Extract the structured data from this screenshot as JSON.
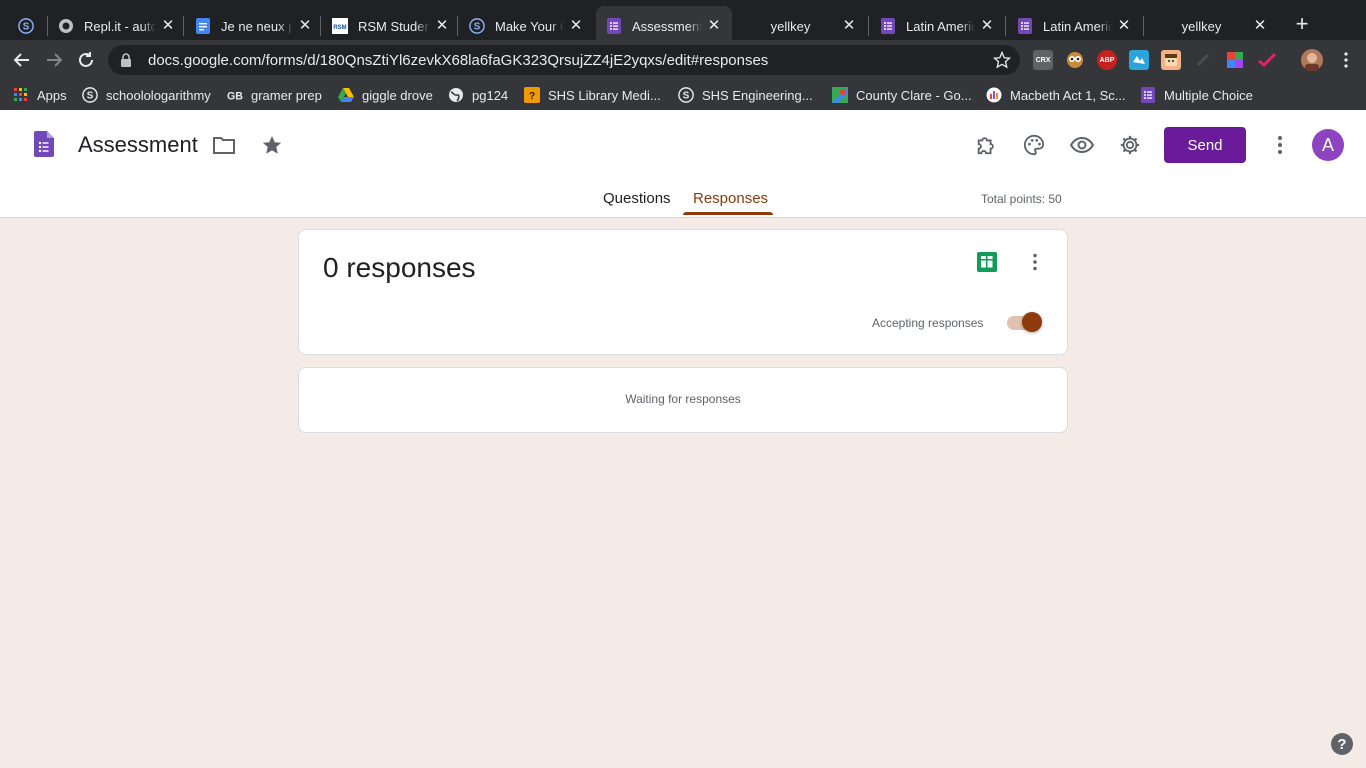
{
  "browser": {
    "tabs": [
      {
        "title": "",
        "icon": "schoology-icon"
      },
      {
        "title": "Repl.it - auto",
        "icon": "replit-icon"
      },
      {
        "title": "Je ne neux pas",
        "icon": "docs-icon"
      },
      {
        "title": "RSM Student",
        "icon": "rsm-icon"
      },
      {
        "title": "Make Your O",
        "icon": "schoology-icon"
      },
      {
        "title": "Assessment",
        "icon": "forms-icon",
        "active": true
      },
      {
        "title": "yellkey",
        "icon": ""
      },
      {
        "title": "Latin Americ",
        "icon": "forms-icon"
      },
      {
        "title": "Latin Americ",
        "icon": "forms-icon"
      },
      {
        "title": "yellkey",
        "icon": ""
      }
    ],
    "new_tab": "+",
    "url": "docs.google.com/forms/d/180QnsZtiYl6zevkX68la6faGK323QrsujZZ4jE2yqxs/edit#responses",
    "extensions": [
      {
        "label": "CRX",
        "icon": "crx-icon"
      },
      {
        "label": "",
        "icon": "owl-icon"
      },
      {
        "label": "ABP",
        "icon": "adblock-icon"
      },
      {
        "label": "",
        "icon": "ext-icon"
      },
      {
        "label": "",
        "icon": "face-icon"
      },
      {
        "label": "",
        "icon": "ext-icon"
      },
      {
        "label": "",
        "icon": "color-icon"
      },
      {
        "label": "",
        "icon": "check-icon"
      }
    ],
    "bookmarks": [
      {
        "label": "Apps",
        "icon": "apps-grid-icon"
      },
      {
        "label": "schoolologarithmy",
        "icon": "schoology-icon"
      },
      {
        "label": "gramer prep",
        "icon": "gb-icon"
      },
      {
        "label": "giggle drove",
        "icon": "drive-icon"
      },
      {
        "label": "pg124",
        "icon": "globe-icon"
      },
      {
        "label": "SHS Library Medi...",
        "icon": "library-icon"
      },
      {
        "label": "SHS Engineering...",
        "icon": "schoology-icon"
      },
      {
        "label": "County Clare - Go...",
        "icon": "maps-icon"
      },
      {
        "label": "Macbeth Act 1, Sc...",
        "icon": "quizlet-icon"
      },
      {
        "label": "Multiple Choice",
        "icon": "forms-icon"
      }
    ]
  },
  "form": {
    "title": "Assessment",
    "send_label": "Send",
    "avatar_letter": "A",
    "tabs": [
      {
        "label": "Questions",
        "active": false
      },
      {
        "label": "Responses",
        "active": true
      }
    ],
    "total_points": "Total points: 50",
    "responses": {
      "count_label": "0 responses",
      "accepting_label": "Accepting responses",
      "accepting": true,
      "waiting_label": "Waiting for responses"
    },
    "help_label": "?"
  },
  "colors": {
    "accent": "#8e3a0c",
    "send": "#6a1b9a",
    "background": "#f4ebe6"
  }
}
